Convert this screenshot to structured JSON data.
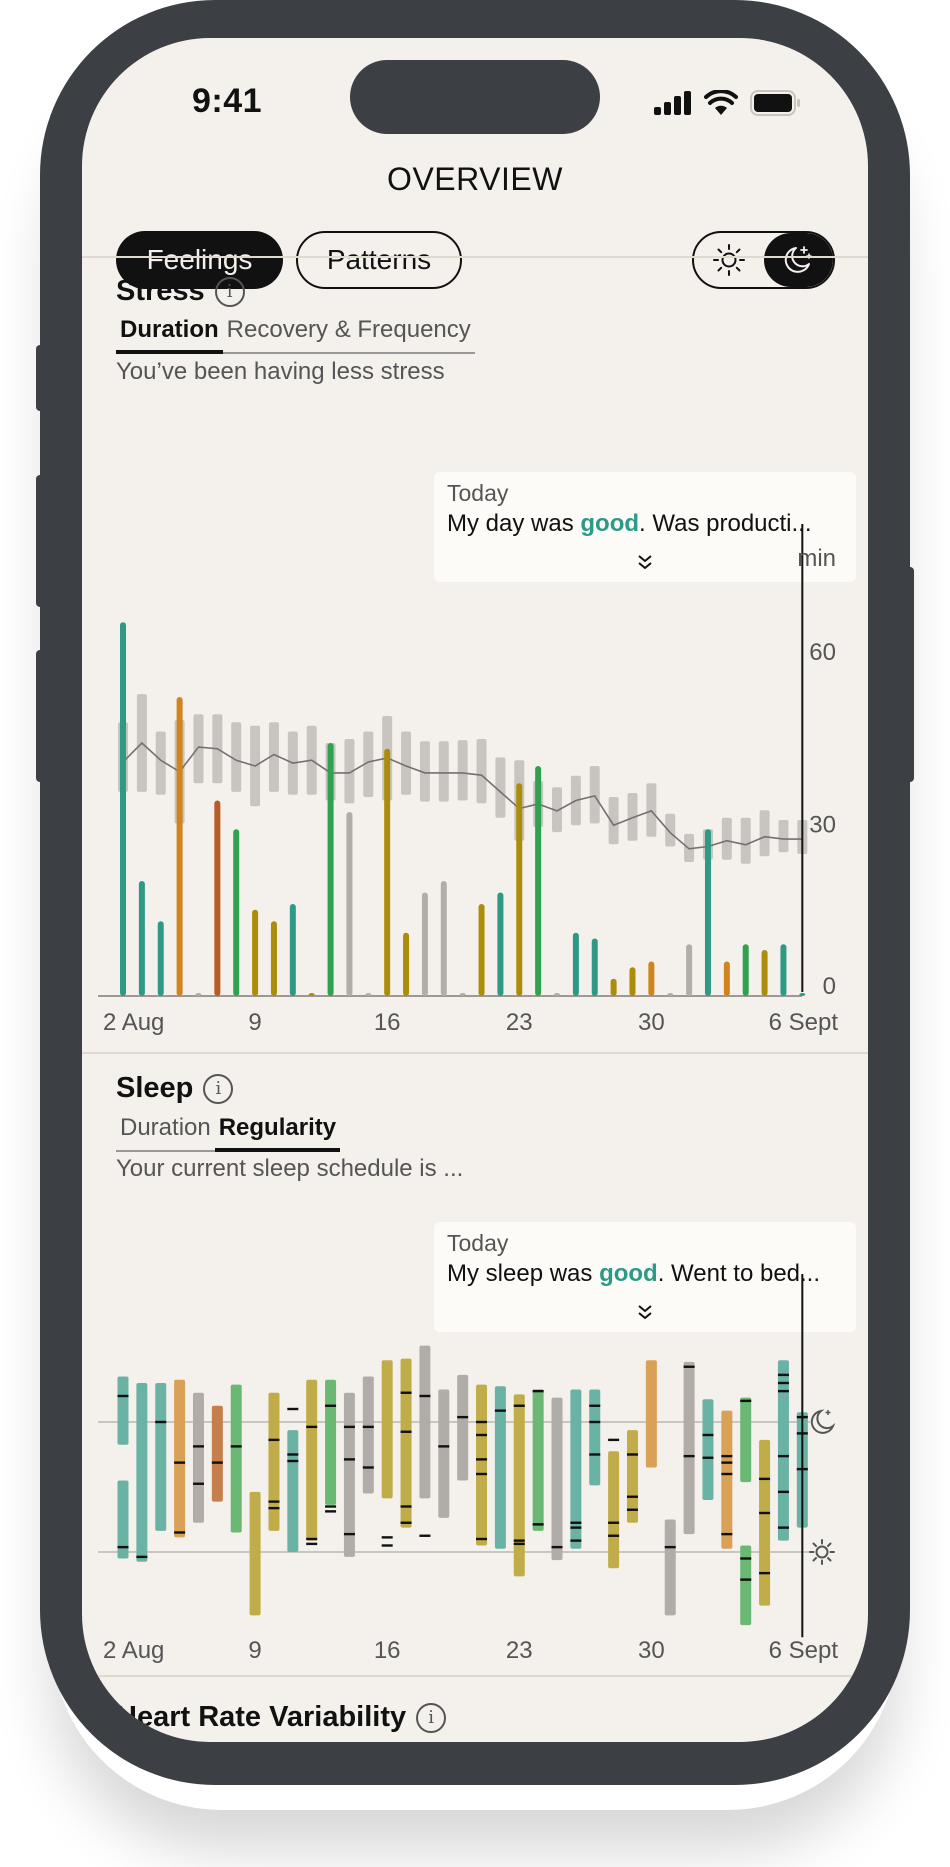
{
  "status_bar": {
    "time": "9:41",
    "icons": [
      "cellular-signal-icon",
      "wifi-icon",
      "battery-icon"
    ]
  },
  "header": {
    "title": "OVERVIEW",
    "segments": [
      {
        "label": "Feelings",
        "active": true
      },
      {
        "label": "Patterns",
        "active": false
      }
    ],
    "theme_toggle": {
      "options": [
        "sun-icon",
        "moon-stars-icon"
      ],
      "selected": "moon-stars-icon"
    }
  },
  "stress": {
    "title": "Stress",
    "info_icon": "info-icon",
    "tabs": [
      {
        "label": "Duration",
        "active": true
      },
      {
        "label": "Recovery & Frequency",
        "active": false
      }
    ],
    "summary": "You’ve been having less stress",
    "tooltip": {
      "date": "Today",
      "text_before": "My day was ",
      "highlight": "good",
      "text_after": ". Was producti...",
      "expand_icon": "double-chevron-down-icon"
    }
  },
  "sleep": {
    "title": "Sleep",
    "info_icon": "info-icon",
    "tabs": [
      {
        "label": "Duration",
        "active": false
      },
      {
        "label": "Regularity",
        "active": true
      }
    ],
    "summary": "Your current sleep schedule is ...",
    "tooltip": {
      "date": "Today",
      "text_before": "My sleep was ",
      "highlight": "good",
      "text_after": ". Went to bed...",
      "expand_icon": "double-chevron-down-icon"
    }
  },
  "hrv": {
    "title": "Heart Rate Variability",
    "info_icon": "info-icon"
  },
  "colors": {
    "teal": "#2e9a86",
    "orange": "#d2841c",
    "rust": "#b85c25",
    "green": "#30a14e",
    "olive": "#ab8d0a",
    "gray": "#b1aea8",
    "band": "#c8c5c0",
    "avg_line": "#737170",
    "highlight": "#2b9a86",
    "sleep_teal": "#6ab3a4",
    "sleep_orange": "#d9a155",
    "sleep_rust": "#c67e4b",
    "sleep_green": "#6ab874",
    "sleep_olive": "#c0ad4a",
    "sleep_gray": "#b0ada8"
  },
  "chart_data": [
    {
      "type": "bar",
      "title": "Stress — Duration",
      "ylabel": "min",
      "ylim": [
        0,
        65
      ],
      "yticks": [
        0,
        30,
        60
      ],
      "xtick_labels": [
        {
          "index": 0,
          "label": "2 Aug"
        },
        {
          "index": 7,
          "label": "9"
        },
        {
          "index": 14,
          "label": "16"
        },
        {
          "index": 21,
          "label": "23"
        },
        {
          "index": 28,
          "label": "30"
        },
        {
          "index": 36,
          "label": "6 Sept"
        }
      ],
      "today_index": 36,
      "series": [
        {
          "name": "daily stress (min)",
          "values": [
            65,
            20,
            13,
            52,
            0,
            34,
            29,
            15,
            13,
            16,
            0,
            44,
            32,
            0,
            43,
            11,
            18,
            20,
            0,
            16,
            18,
            37,
            40,
            0,
            11,
            10,
            3,
            5,
            6,
            0,
            9,
            29,
            6,
            9,
            8,
            9,
            0
          ],
          "colors": [
            "teal",
            "teal",
            "teal",
            "orange",
            "gray",
            "rust",
            "green",
            "olive",
            "olive",
            "teal",
            "olive",
            "green",
            "gray",
            "gray",
            "olive",
            "olive",
            "gray",
            "gray",
            "gray",
            "olive",
            "teal",
            "olive",
            "green",
            "gray",
            "teal",
            "teal",
            "olive",
            "olive",
            "orange",
            "gray",
            "gray",
            "teal",
            "orange",
            "green",
            "olive",
            "teal",
            "teal"
          ]
        },
        {
          "name": "typical range (min)",
          "low": [
            35.5,
            35.5,
            35,
            30,
            37,
            37,
            35.5,
            33,
            35.5,
            35,
            35,
            34,
            33.5,
            34.6,
            34,
            35,
            33.8,
            33.8,
            34,
            33.5,
            31,
            27,
            29.4,
            28.5,
            29.7,
            30,
            26.4,
            27,
            27.7,
            26,
            23.3,
            23.7,
            23.7,
            23,
            24.3,
            25,
            24.7
          ],
          "high": [
            47.6,
            52.5,
            46,
            48,
            49,
            49,
            47.6,
            47,
            47.6,
            46,
            47,
            44,
            44.7,
            46,
            48.7,
            46,
            44.3,
            44.3,
            44.5,
            44.7,
            41.5,
            41,
            37.4,
            36.3,
            38.3,
            40,
            34.6,
            35.3,
            37,
            31.7,
            28.2,
            29,
            31,
            31,
            32.3,
            30.6,
            30.6
          ]
        },
        {
          "name": "rolling average (min)",
          "values": [
            40.7,
            44,
            41,
            39,
            43.3,
            43,
            41,
            40,
            42,
            40.5,
            41,
            38.8,
            38.8,
            40.7,
            41.4,
            40,
            38.8,
            38.8,
            38.8,
            38.4,
            35.5,
            32.6,
            33.4,
            32.2,
            34,
            34.8,
            29.7,
            31,
            32.2,
            28.4,
            25.6,
            26,
            27,
            26.3,
            27.7,
            27.3,
            27.3
          ]
        }
      ]
    },
    {
      "type": "bar",
      "title": "Sleep — Regularity",
      "ylabel": "",
      "reference_lines": [
        {
          "hours_offset": 0,
          "icon": "moon-stars-icon"
        },
        {
          "hours_offset": 8,
          "icon": "sun-icon"
        }
      ],
      "ylim_hours_offset": [
        -5,
        13
      ],
      "xtick_labels": [
        {
          "index": 0,
          "label": "2 Aug"
        },
        {
          "index": 7,
          "label": "9"
        },
        {
          "index": 14,
          "label": "16"
        },
        {
          "index": 21,
          "label": "23"
        },
        {
          "index": 28,
          "label": "30"
        },
        {
          "index": 36,
          "label": "6 Sept"
        }
      ],
      "today_index": 36,
      "series": [
        {
          "name": "sleep periods (hours from bedtime reference)",
          "segments": [
            [
              [
                -2.8,
                1.4
              ],
              [
                3.6,
                8.4
              ]
            ],
            [
              [
                -2.4,
                8.6
              ]
            ],
            [
              [
                -2.4,
                6.7
              ]
            ],
            [
              [
                -2.6,
                7.1
              ]
            ],
            [
              [
                -1.8,
                6.2
              ]
            ],
            [
              [
                -1.0,
                4.9
              ]
            ],
            [
              [
                -2.3,
                6.8
              ]
            ],
            [
              [
                4.3,
                11.9
              ]
            ],
            [
              [
                -1.8,
                6.7
              ]
            ],
            [
              [
                0.5,
                8.0
              ]
            ],
            [
              [
                -2.6,
                7.3
              ]
            ],
            [
              [
                -2.6,
                5.1
              ]
            ],
            [
              [
                -1.8,
                8.3
              ]
            ],
            [
              [
                -2.8,
                4.4
              ]
            ],
            [
              [
                -3.8,
                4.7
              ]
            ],
            [
              [
                -3.9,
                6.5
              ]
            ],
            [
              [
                -4.7,
                4.7
              ]
            ],
            [
              [
                -2.0,
                5.9
              ]
            ],
            [
              [
                -2.9,
                3.6
              ]
            ],
            [
              [
                -2.3,
                7.6
              ]
            ],
            [
              [
                -2.2,
                7.8
              ]
            ],
            [
              [
                -1.7,
                9.5
              ]
            ],
            [
              [
                -2.0,
                6.7
              ]
            ],
            [
              [
                -1.5,
                8.5
              ]
            ],
            [
              [
                -2.0,
                7.8
              ]
            ],
            [
              [
                -2.0,
                3.9
              ]
            ],
            [
              [
                1.8,
                9.0
              ]
            ],
            [
              [
                0.5,
                6.2
              ]
            ],
            [
              [
                -3.8,
                2.8
              ]
            ],
            [
              [
                6.0,
                11.9
              ]
            ],
            [
              [
                -3.7,
                6.9
              ]
            ],
            [
              [
                -1.4,
                4.8
              ]
            ],
            [
              [
                -0.7,
                7.8
              ]
            ],
            [
              [
                -1.5,
                3.7
              ],
              [
                7.6,
                12.5
              ]
            ],
            [
              [
                1.1,
                11.3
              ]
            ],
            [
              [
                -3.8,
                7.3
              ]
            ],
            [
              [
                -0.6,
                6.5
              ]
            ]
          ],
          "marks": [
            [
              -1.6,
              7.7
            ],
            [
              8.3
            ],
            [
              0
            ],
            [
              2.5,
              6.8
            ],
            [
              1.5,
              3.8
            ],
            [
              2.5
            ],
            [
              1.5
            ],
            [],
            [
              1.1,
              4.9,
              5.3
            ],
            [
              -0.8,
              2.0,
              2.4
            ],
            [
              0.3,
              7.2,
              7.5
            ],
            [
              -1.0,
              5.2,
              5.5
            ],
            [
              0.3,
              2.3,
              6.9
            ],
            [
              0.3,
              2.8
            ],
            [
              7.1,
              7.6
            ],
            [
              -1.8,
              0.6,
              5.2,
              6.2
            ],
            [
              -1.6,
              7.0
            ],
            [
              1.5
            ],
            [
              -0.3
            ],
            [
              0,
              0.8,
              2.3,
              3.2,
              7.2
            ],
            [
              -0.7
            ],
            [
              -1.0,
              7.3,
              7.5
            ],
            [
              -1.9,
              6.3
            ],
            [
              7.7
            ],
            [
              6.2,
              6.5,
              7.3
            ],
            [
              -1.0,
              0,
              2.0
            ],
            [
              1.1,
              6.2,
              7.0
            ],
            [
              2.0,
              4.6,
              5.4
            ],
            [],
            [
              7.7
            ],
            [
              -3.4,
              2.1
            ],
            [
              0.8,
              2.2
            ],
            [
              2.1,
              2.5,
              3.2,
              6.9
            ],
            [
              -1.3,
              8.4,
              9.7
            ],
            [
              3.5,
              5.6,
              9.3
            ],
            [
              -2.9,
              -2.4,
              -1.9,
              2.1,
              4.3,
              6.5
            ],
            [
              -0.3,
              0.7,
              2.9
            ]
          ],
          "colors": [
            "teal",
            "teal",
            "teal",
            "orange",
            "gray",
            "rust",
            "green",
            "olive",
            "olive",
            "teal",
            "olive",
            "green",
            "gray",
            "gray",
            "olive",
            "olive",
            "gray",
            "gray",
            "gray",
            "olive",
            "teal",
            "olive",
            "green",
            "gray",
            "teal",
            "teal",
            "olive",
            "olive",
            "orange",
            "gray",
            "gray",
            "teal",
            "orange",
            "green",
            "olive",
            "teal",
            "teal"
          ]
        }
      ]
    }
  ]
}
